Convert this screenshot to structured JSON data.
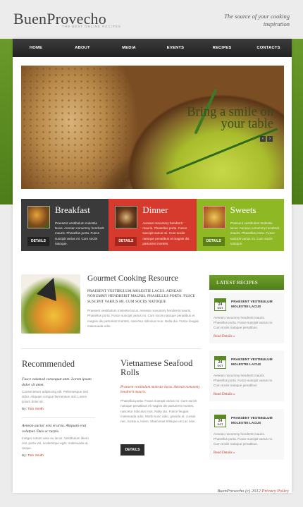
{
  "header": {
    "logo": "BuenProvecho",
    "logo_sub": "THE BEST ONLINE RECIPES",
    "tagline": "The source of your cooking inspiration"
  },
  "nav": [
    {
      "label": "HOME"
    },
    {
      "label": "ABOUT"
    },
    {
      "label": "MEDIA"
    },
    {
      "label": "EVENTS"
    },
    {
      "label": "RECIPES"
    },
    {
      "label": "CONTACTS"
    }
  ],
  "slider": {
    "title_line1": "Bring a smile on",
    "title_line2": "your table",
    "prev": "‹",
    "next": "›"
  },
  "boxes": [
    {
      "title": "Breakfast",
      "text": "Praesent vestibulum molestie lacus. Aenean nonummy hendrerit mauris. Phasellus porta. Fusce suscipit varius mi. Cum sociis natoque.",
      "button": "DETAILS"
    },
    {
      "title": "Dinner",
      "text": "Aenean nonummy hendrerit mauris. Phasellus porta. Fusce suscipit varius mi. Cum sociis natoque penatibus et magnis dis parturient montes.",
      "button": "DETAILS"
    },
    {
      "title": "Sweets",
      "text": "Praesent vestibulum molestie lacus. Aenean nonummy hendrerit mauris. Phasellus porta. Fusce suscipit varius mi. Cum sociis natoque.",
      "button": "DETAILS"
    }
  ],
  "gourmet": {
    "title": "Gourmet Cooking Resource",
    "head": "PRAESENT VESTIBULUM MOLESTIE LACUS. AENEAN NONUMMY HENDRERIT MAURIS. PHASELLUS PORTA. FUSCE SUSCIPIT VARIUS MI. CUM SOCIIS NATOQUE",
    "text": "Praesent vestibulum molestie lacus. Aenean nonummy hendrerit mauris. Phasellus porta. Fusce suscipit varius mi. Cum sociis natoque penatibus et magnis dis parturient montes, nascetur ridiculus mus. Nulla dui. Fusce feugiat malesuada odio."
  },
  "recommended": {
    "title": "Recommended",
    "items": [
      {
        "head": "Fusce euismod consequat ante. Lorem ipsum dolor sit amet.",
        "text": "Consectetuer adipiscing elit. Pellentesque sed dolor. Aliquam congue fermentum nisl. Lorem ipsum dolor sit.",
        "by": "By:",
        "author": "Tom Smith"
      },
      {
        "head": "Aenean auctor wisi et urna. Aliquam erat volutpat. Duis ac turpis.",
        "text": "Integer rutrum ante eu lacus. Vestibulum libero nisl, porta vel, scelerisque eget, malesuada at, neque.",
        "by": "By:",
        "author": "Tom Smith"
      }
    ]
  },
  "vietnamese": {
    "title": "Vietnamese Seafood Rolls",
    "sub": "Praesent vestibulum molestie lacus. Aenean nonummy hendrerit mauris.",
    "text": "Phasellus porta. Fusce suscipit varius mi. Cum sociis natoque penatibus et magnis dis parturient montes, nascetur ridiculus mus. Nulla dui. Fusce feugiat malesuada odio. Morbi nunc odio, gravida at, cursus nec, luctus a, lorem. Maecenas tristique orci ac sem.",
    "button": "DETAILS"
  },
  "latest": {
    "heading": "LATEST RECIPES",
    "items": [
      {
        "month": "OCT",
        "day": "24",
        "title": "PRAESENT VESTIBULUM MOLESTIE LACUS",
        "text": "Aenean nonummy hendrerit mauris. Phasellus porta. Fusce suscipit varius mi. Cum sociis natoque penatibus.",
        "more": "Read Details »"
      },
      {
        "month": "OCT",
        "day": "24",
        "title": "PRAESENT VESTIBULUM MOLESTIE LACUS",
        "text": "Aenean nonummy hendrerit mauris. Phasellus porta. Fusce suscipit varius mi. Cum sociis natoque penatibus.",
        "more": "Read Details »"
      },
      {
        "month": "OCT",
        "day": "24",
        "title": "PRAESENT VESTIBULUM MOLESTIE LACUS",
        "text": "Aenean nonummy hendrerit mauris. Phasellus porta. Fusce suscipit varius mi. Cum sociis natoque penatibus.",
        "more": "Read Details »"
      }
    ]
  },
  "footer": {
    "copyright": "BuenProvecho (c) 2012",
    "privacy": "Privacy Policy"
  }
}
